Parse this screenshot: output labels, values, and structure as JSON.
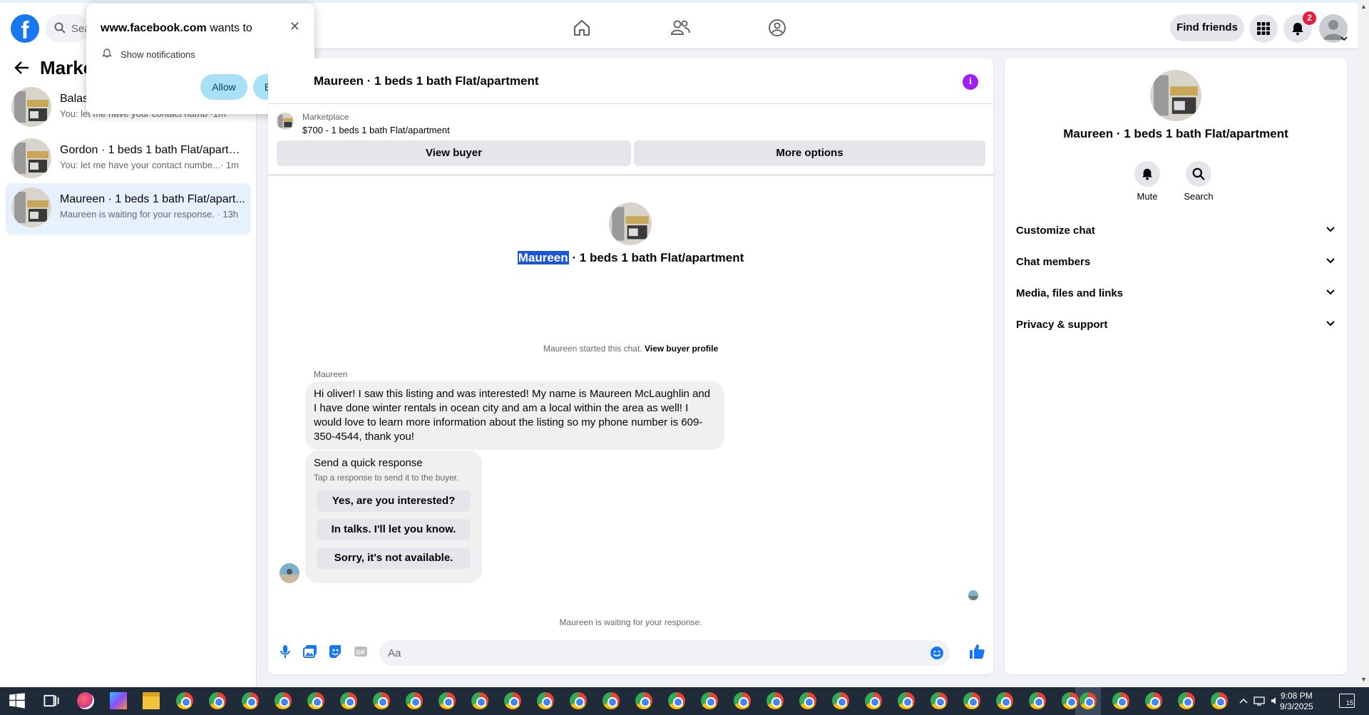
{
  "topnav": {
    "logo": "f",
    "search_placeholder": "Sea",
    "find_friends": "Find friends",
    "notification_count": "2"
  },
  "popup": {
    "site": "www.facebook.com",
    "wants_to": "wants to",
    "permission": "Show notifications",
    "allow": "Allow",
    "block": "Block"
  },
  "sidebar": {
    "title": "Marke",
    "conversations": [
      {
        "name": "Balas",
        "preview": "You: let me have your contact numb",
        "time": "·1m"
      },
      {
        "name": "Gordon · 1 beds 1 bath Flat/apartm...",
        "preview": "You: let me have your contact numbe...",
        "time": "· 1m"
      },
      {
        "name": "Maureen · 1 beds 1 bath Flat/apart...",
        "preview": "Maureen is waiting for your response.",
        "time": "· 13h"
      }
    ]
  },
  "chat": {
    "title": "Maureen · 1 beds 1 bath Flat/apartment",
    "marketplace_label": "Marketplace",
    "listing": "$700 - 1 beds 1 bath Flat/apartment",
    "view_buyer": "View buyer",
    "more_options": "More options",
    "hero_name_highlight": "Maureen",
    "hero_name_rest": " · 1 beds 1 bath Flat/apartment",
    "started_text": "Maureen started this chat.",
    "view_buyer_profile": "View buyer profile",
    "sender": "Maureen",
    "message": "Hi oliver! I saw this listing and was interested! My name is Maureen McLaughlin and I have done winter rentals in ocean city and am a local within the area as well! I would love to learn more information about the listing so my phone number is 609-350-4544, thank you!",
    "quick_title": "Send a quick response",
    "quick_subtitle": "Tap a response to send it to the buyer.",
    "quick_options": [
      "Yes, are you interested?",
      "In talks. I'll let you know.",
      "Sorry, it's not available."
    ],
    "waiting": "Maureen is waiting for your response.",
    "composer_placeholder": "Aa"
  },
  "details": {
    "name": "Maureen · 1 beds 1 bath Flat/apartment",
    "mute": "Mute",
    "search": "Search",
    "sections": [
      "Customize chat",
      "Chat members",
      "Media, files and links",
      "Privacy & support"
    ]
  },
  "taskbar": {
    "time": "9:08 PM",
    "date": "9/3/2025",
    "notif_count": "15"
  },
  "colors": {
    "facebook_blue": "#1877f2",
    "accent_purple": "#a020f0",
    "highlight": "#1a56d6"
  }
}
